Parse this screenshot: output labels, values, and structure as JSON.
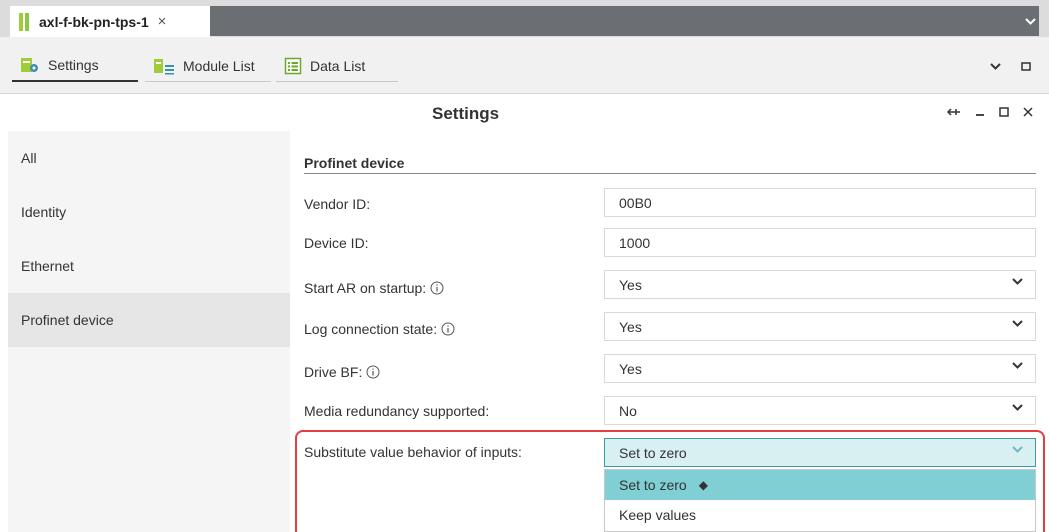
{
  "doc_tab": {
    "title": "axl-f-bk-pn-tps-1",
    "close_glyph": "×"
  },
  "subtabs": [
    {
      "label": "Settings",
      "icon": "settings-gear-icon"
    },
    {
      "label": "Module List",
      "icon": "module-list-icon"
    },
    {
      "label": "Data List",
      "icon": "data-list-icon"
    }
  ],
  "panel": {
    "title": "Settings"
  },
  "nav": {
    "items": [
      "All",
      "Identity",
      "Ethernet",
      "Profinet device"
    ],
    "active": "Profinet device"
  },
  "section": {
    "title": "Profinet device"
  },
  "fields": {
    "vendor_id": {
      "label": "Vendor ID:",
      "value": "00B0"
    },
    "device_id": {
      "label": "Device ID:",
      "value": "1000"
    },
    "start_ar": {
      "label": "Start AR on startup:",
      "value": "Yes"
    },
    "log_conn": {
      "label": "Log connection state:",
      "value": "Yes"
    },
    "drive_bf": {
      "label": "Drive BF:",
      "value": "Yes"
    },
    "media_red": {
      "label": "Media redundancy supported:",
      "value": "No"
    },
    "subst": {
      "label": "Substitute value behavior of inputs:",
      "value": "Set to zero"
    }
  },
  "dropdown": {
    "options": [
      "Set to zero",
      "Keep values"
    ],
    "selected_marker": "◆"
  },
  "colors": {
    "accent_teal": "#7fcfd4",
    "focus_teal": "#3a9aa4",
    "highlight_red": "#e53e3e",
    "brand_green": "#8dc63f"
  }
}
